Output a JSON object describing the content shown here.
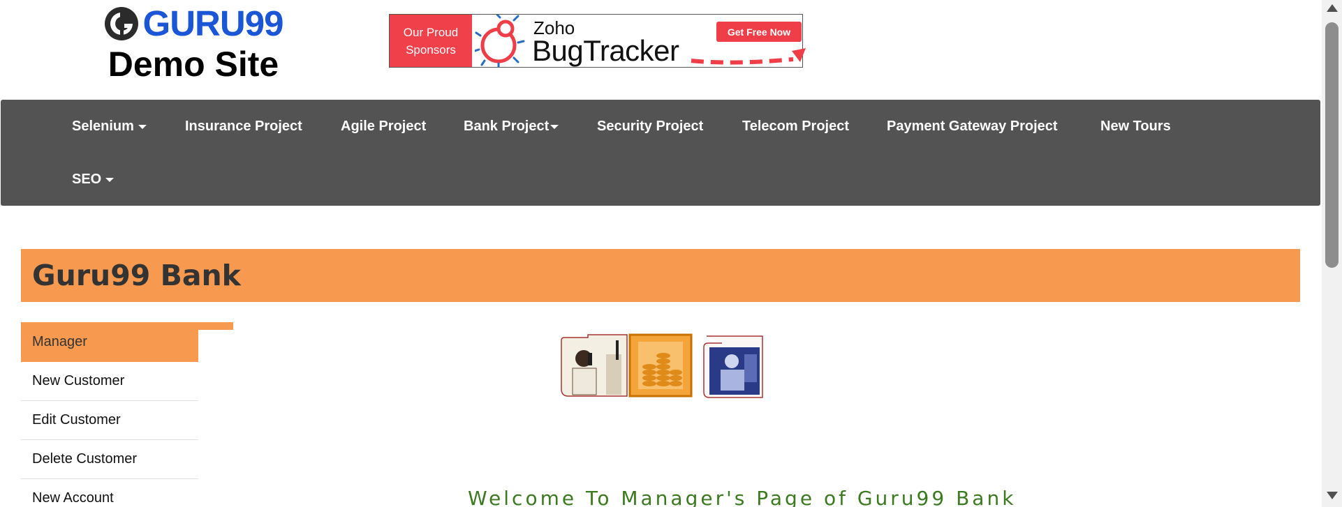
{
  "header": {
    "logo_text": "GURU99",
    "logo_subtitle": "Demo Site",
    "logo_icon": "guru99-logo-icon"
  },
  "banner": {
    "left_line1": "Our Proud",
    "left_line2": "Sponsors",
    "brand_small": "Zoho",
    "brand_large": "BugTracker",
    "cta": "Get Free Now",
    "icon": "bug-icon",
    "accent_color": "#f0404a"
  },
  "nav": {
    "items": [
      {
        "label": "Selenium",
        "dropdown": true
      },
      {
        "label": "Insurance Project",
        "dropdown": false
      },
      {
        "label": "Agile Project",
        "dropdown": false
      },
      {
        "label": "Bank Project",
        "dropdown": true
      },
      {
        "label": "Security Project",
        "dropdown": false
      },
      {
        "label": "Telecom Project",
        "dropdown": false
      },
      {
        "label": "Payment Gateway Project",
        "dropdown": false
      },
      {
        "label": "New Tours",
        "dropdown": false
      },
      {
        "label": "SEO",
        "dropdown": true
      }
    ],
    "background": "#535353"
  },
  "page": {
    "title": "Guru99 Bank",
    "accent_color": "#f79a50",
    "welcome": "Welcome To Manager's Page of Guru99 Bank",
    "welcome_color": "#3b7a1f"
  },
  "sidebar": {
    "active": "Manager",
    "items": [
      "New Customer",
      "Edit Customer",
      "Delete Customer",
      "New Account"
    ]
  },
  "images": {
    "alt_icons": [
      "man-on-phone-photo",
      "coin-stack-photo",
      "woman-at-desk-photo"
    ]
  }
}
